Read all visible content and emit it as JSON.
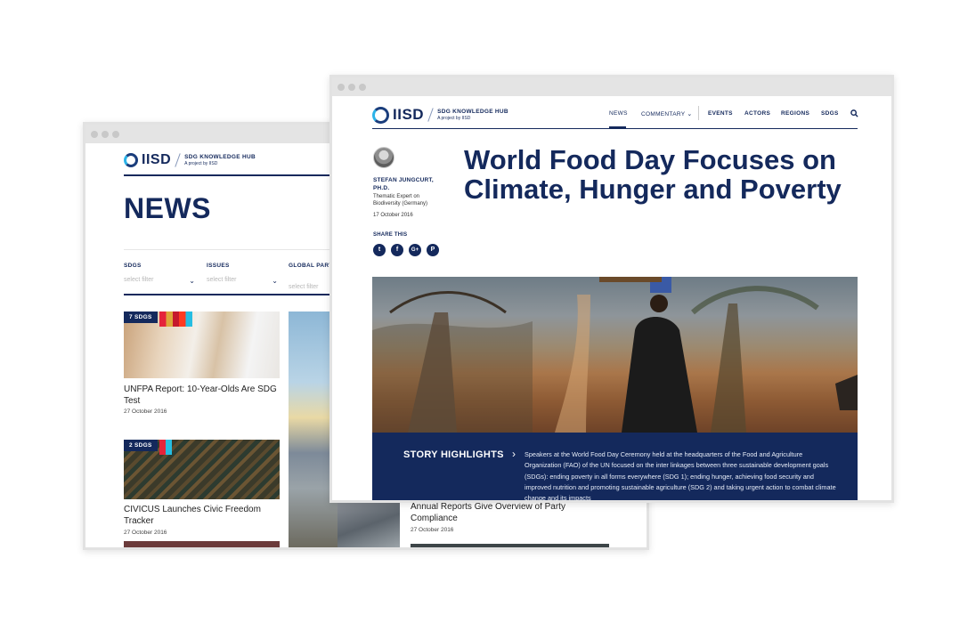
{
  "back_window": {
    "logo": {
      "word": "IISD",
      "hub": "SDG KNOWLEDGE HUB",
      "sub": "A project by IISD"
    },
    "page_title": "NEWS",
    "filters": [
      {
        "label": "SDGS",
        "placeholder": "select filter"
      },
      {
        "label": "ISSUES",
        "placeholder": "select filter"
      },
      {
        "label": "GLOBAL PARTN",
        "placeholder": "select filter"
      }
    ],
    "cards": [
      {
        "badge": "7 SDGS",
        "title": "UNFPA Report: 10-Year-Olds Are SDG Test",
        "date": "27 October 2016"
      },
      {
        "badge": "2 SDGS",
        "title": "CIVICUS Launches Civic Freedom Tracker",
        "date": "27 October 2016"
      },
      {
        "title": "Annual Reports Give Overview of Party Compliance",
        "date": "27 October 2016"
      }
    ]
  },
  "front_window": {
    "logo": {
      "word": "IISD",
      "hub": "SDG KNOWLEDGE HUB",
      "sub": "A project by IISD"
    },
    "nav": {
      "news": "NEWS",
      "commentary": "COMMENTARY",
      "events": "EVENTS",
      "actors": "ACTORS",
      "regions": "REGIONS",
      "sdgs": "SDGS"
    },
    "author": {
      "name": "STEFAN JUNGCURT, PH.D.",
      "role": "Thematic Expert on Biodiversity (Germany)",
      "date": "17 October 2016"
    },
    "share": {
      "label": "SHARE THIS",
      "buttons": [
        "t",
        "f",
        "G+",
        "P"
      ]
    },
    "article_title": "World Food Day Focuses on Climate, Hunger and Poverty",
    "highlights": {
      "label": "STORY HIGHLIGHTS",
      "text": "Speakers at the World Food Day Ceremony held at the headquarters of the Food and Agriculture Organization (FAO) of the UN focused on the inter linkages between three sustainable development goals (SDGs): ending poverty in all forms everywhere (SDG 1); ending hunger, achieving food security and improved nutrition and promoting sustainable agriculture (SDG 2) and taking urgent action to combat climate change and its impacts"
    }
  },
  "colors": {
    "navy": "#14295c",
    "accent": "#2cb3e8"
  },
  "icons": [
    "search-icon",
    "chevron-down-icon",
    "twitter-icon",
    "facebook-icon",
    "googleplus-icon",
    "pinterest-icon",
    "chevron-right-icon"
  ]
}
